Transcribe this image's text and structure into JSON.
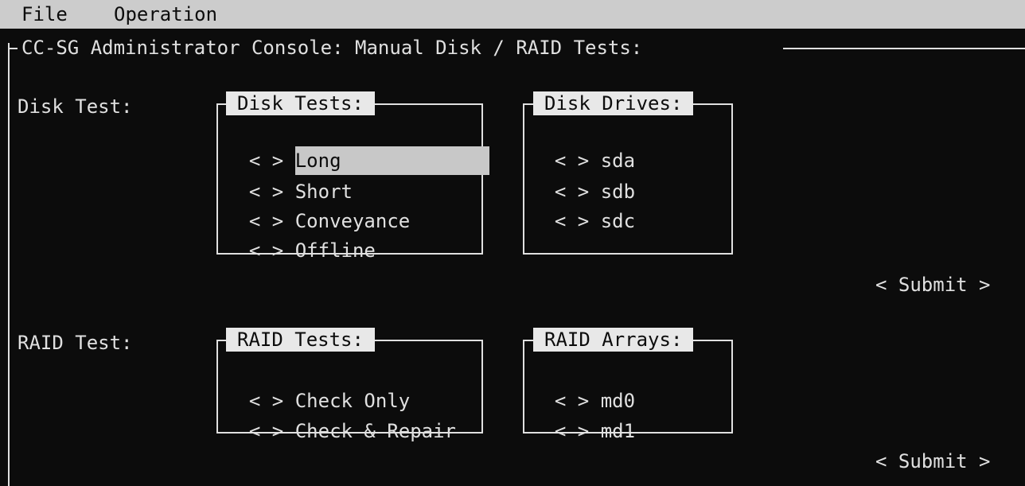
{
  "menubar": {
    "items": [
      "File",
      "Operation"
    ]
  },
  "window": {
    "title": "CC-SG Administrator Console: Manual Disk / RAID Tests:"
  },
  "disk_section": {
    "label": "Disk Test:",
    "tests_box": {
      "title": "Disk Tests:",
      "options": [
        "Long",
        "Short",
        "Conveyance",
        "Offline"
      ],
      "highlighted": "Long"
    },
    "drives_box": {
      "title": "Disk Drives:",
      "options": [
        "sda",
        "sdb",
        "sdc"
      ]
    },
    "submit_label": "< Submit >"
  },
  "raid_section": {
    "label": "RAID Test:",
    "tests_box": {
      "title": "RAID Tests:",
      "options": [
        "Check Only",
        "Check & Repair"
      ]
    },
    "arrays_box": {
      "title": "RAID Arrays:",
      "options": [
        "md0",
        "md1"
      ]
    },
    "submit_label": "< Submit >"
  },
  "radio_glyph": "< >",
  "colors": {
    "background": "#0c0c0c",
    "foreground": "#e0e0e0",
    "menubar": "#cccccc",
    "highlight": "#c8c8c8"
  }
}
